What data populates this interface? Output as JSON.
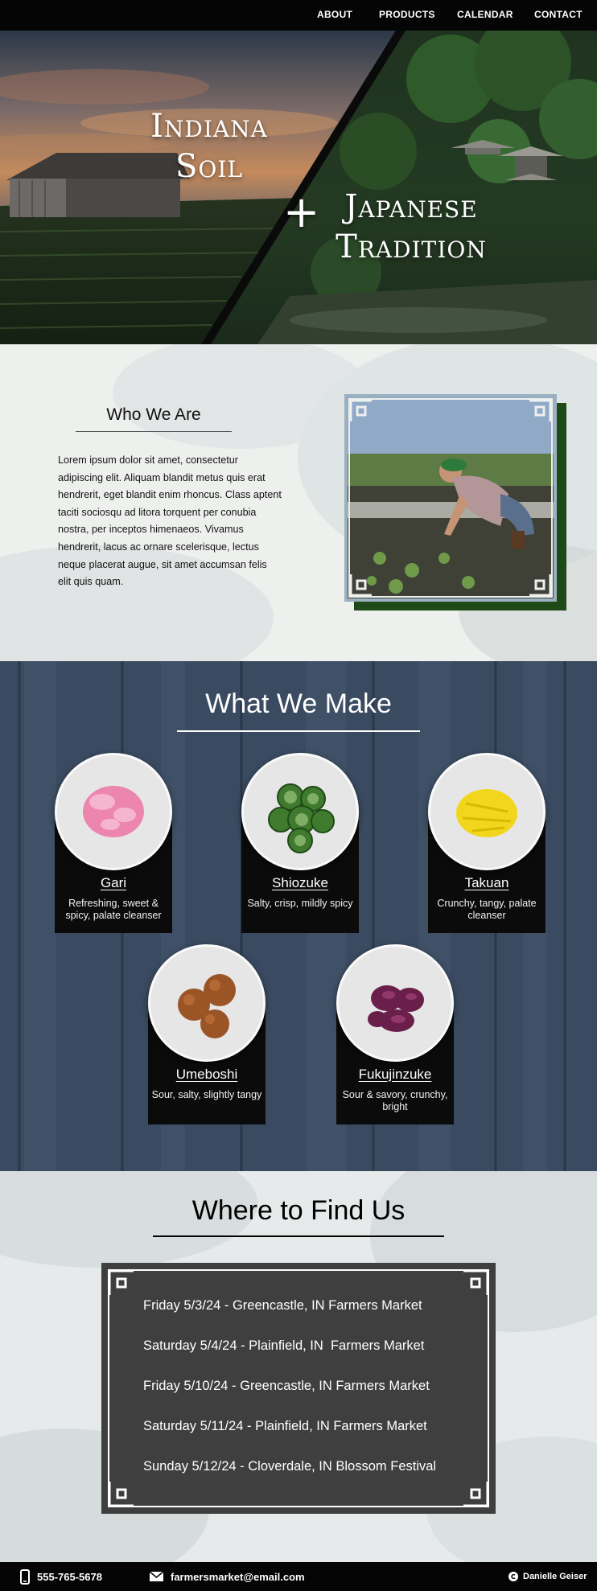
{
  "nav": {
    "items": [
      "ABOUT",
      "PRODUCTS",
      "CALENDAR",
      "CONTACT"
    ]
  },
  "hero": {
    "left_title_1": "Indiana",
    "left_title_2": "Soil",
    "plus": "+",
    "right_title_1": "Japanese",
    "right_title_2": "Tradition"
  },
  "who": {
    "heading": "Who We Are",
    "body": "Lorem ipsum dolor sit amet, consectetur adipiscing elit. Aliquam blandit metus quis erat hendrerit, eget blandit enim rhoncus. Class aptent taciti sociosqu ad litora torquent per conubia nostra, per inceptos himenaeos. Vivamus hendrerit, lacus ac ornare scelerisque, lectus neque placerat augue, sit amet accumsan felis elit quis quam."
  },
  "make": {
    "heading": "What We Make",
    "products": [
      {
        "name": "Gari",
        "desc": "Refreshing, sweet & spicy, palate cleanser",
        "color": "#ec86ae"
      },
      {
        "name": "Shiozuke",
        "desc": "Salty, crisp, mildly spicy",
        "color": "#4f8a3c"
      },
      {
        "name": "Takuan",
        "desc": "Crunchy, tangy, palate cleanser",
        "color": "#f2d61e"
      },
      {
        "name": "Umeboshi",
        "desc": "Sour, salty, slightly tangy",
        "color": "#9a5426"
      },
      {
        "name": "Fukujinzuke",
        "desc": "Sour & savory, crunchy, bright",
        "color": "#6a1f4a"
      }
    ]
  },
  "where": {
    "heading": "Where to Find Us",
    "events": [
      "Friday 5/3/24 - Greencastle, IN Farmers Market",
      "Saturday 5/4/24 - Plainfield, IN  Farmers Market",
      "Friday 5/10/24 - Greencastle, IN Farmers Market",
      "Saturday 5/11/24 - Plainfield, IN Farmers Market",
      "Sunday 5/12/24 - Cloverdale, IN Blossom Festival"
    ]
  },
  "footer": {
    "phone": "555-765-5678",
    "email": "farmersmarket@email.com",
    "credit": "Danielle Geiser"
  },
  "colors": {
    "nav_bg": "#050505",
    "wood_bg": "#3a4a60",
    "board_bg": "#3f3f3f",
    "frame_shadow": "#1e4a17"
  }
}
